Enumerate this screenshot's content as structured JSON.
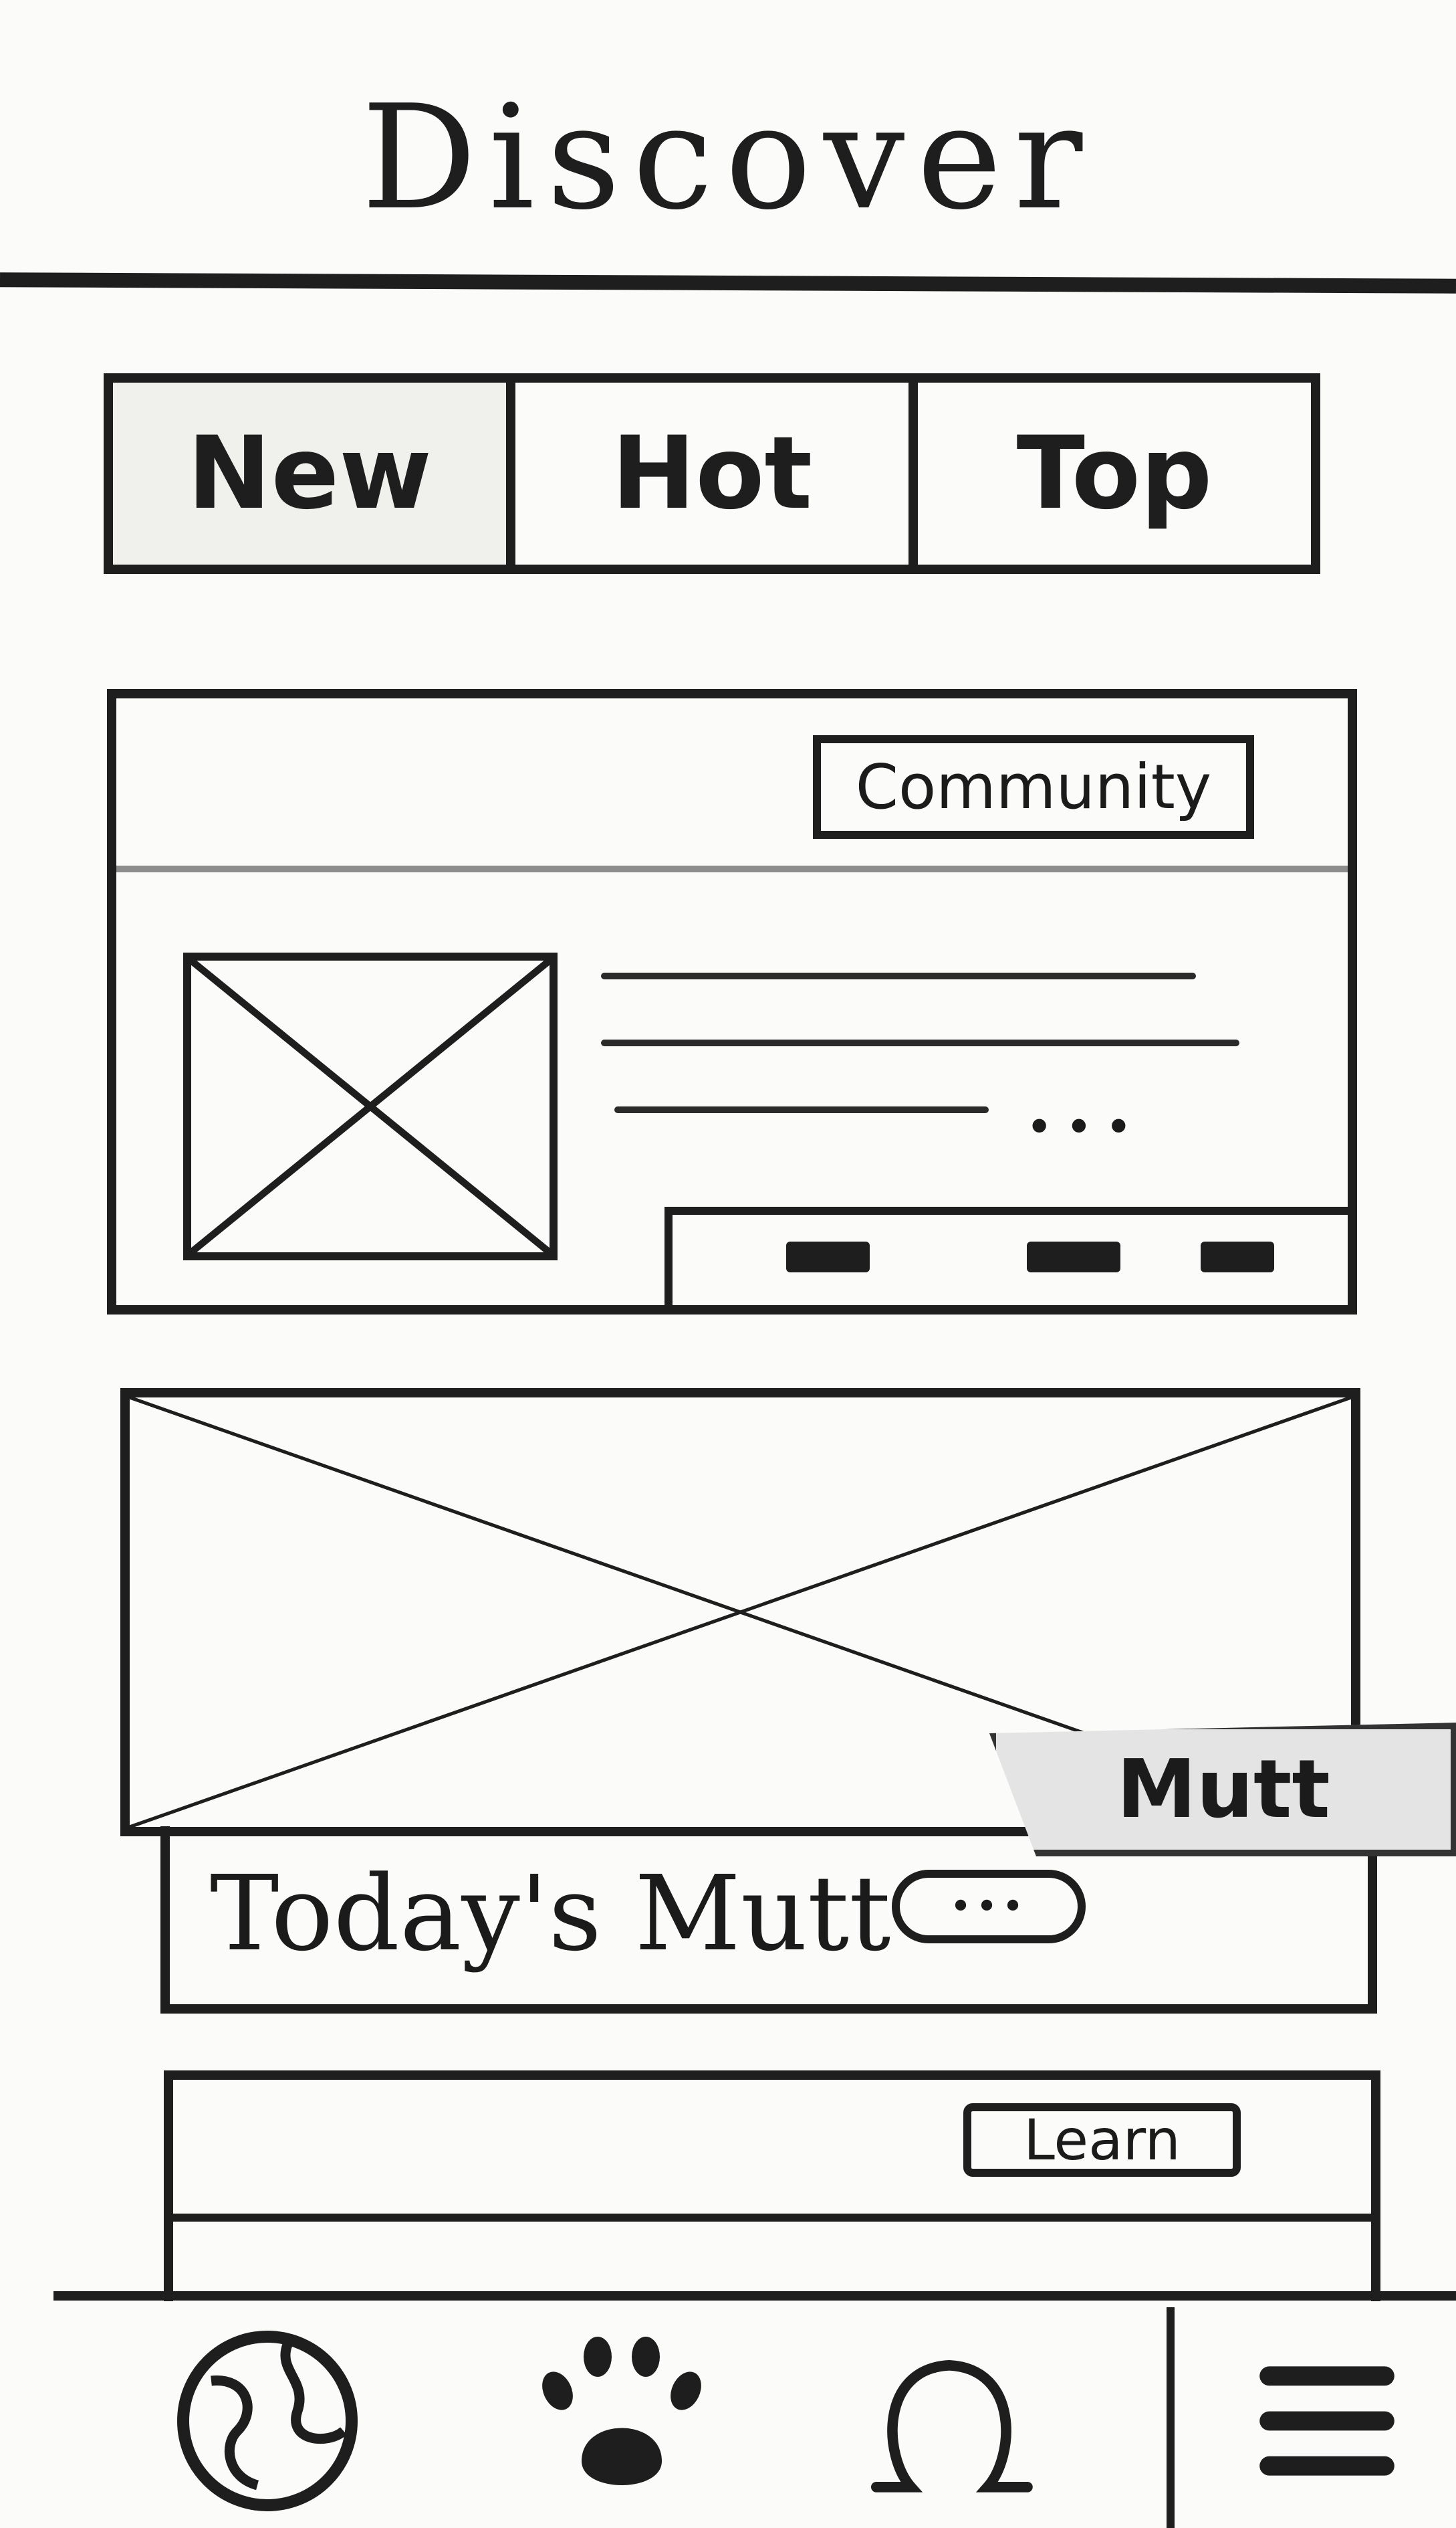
{
  "header": {
    "title": "Discover"
  },
  "tabs": [
    {
      "label": "New",
      "active": true
    },
    {
      "label": "Hot",
      "active": false
    },
    {
      "label": "Top",
      "active": false
    }
  ],
  "feed": {
    "community_card": {
      "badge": "Community",
      "more": "•••"
    },
    "mutt_card": {
      "title": "Today's Mutt",
      "more": "•••",
      "tag": "Mutt"
    },
    "learn_card": {
      "badge": "Learn"
    }
  },
  "bottom_nav": {
    "items": [
      {
        "icon": "globe-icon"
      },
      {
        "icon": "paw-icon"
      },
      {
        "icon": "omega-icon"
      },
      {
        "icon": "hamburger-menu-icon"
      }
    ]
  },
  "colors": {
    "ink": "#1e1e1e",
    "paper": "#fbfbf9",
    "tag_fill": "#e4e4e4"
  }
}
